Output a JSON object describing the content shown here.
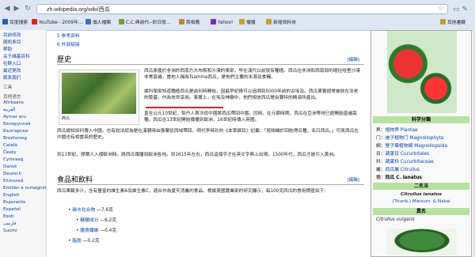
{
  "browser": {
    "url": "zh.wikipedia.org/wiki/西瓜",
    "bookmarks": [
      "百度搜索",
      "YouTube - 2009年...",
      "個人檔案",
      "C.C.典前代--即日般...",
      "我相應",
      "Yahoo!",
      "播播",
      "新增資料夾"
    ],
    "other_bookmarks": "其他書籤"
  },
  "sidebar": {
    "items": [
      "目前修改",
      "随机条目",
      "帮助",
      "关于维基百科",
      "社群入口",
      "最近更改",
      "联系我们",
      "工具",
      "其他语言",
      "Afrikaans",
      "العربية",
      "Aymar aru",
      "Беларуская",
      "Български",
      "Brezhoneg",
      "Català",
      "Česky",
      "Cymraeg",
      "Dansk",
      "Deutsch",
      "Ελληνικά",
      "Emiliàn e rumagnòl",
      "English",
      "Esperanto",
      "Español",
      "Eesti",
      "فارسی",
      "Suomi"
    ]
  },
  "content": {
    "toc": [
      "5 参考资料",
      "6 外部链接"
    ],
    "section_history": "歷史",
    "edit_label": "[編輯]",
    "history_para1": "西瓜原產於非洲的西南方大布斯和沙漠的東部，早在漢代以前就有種植。西瓜在非洲和西南部的喀拉哈里沙漠非常普遍，當地人稱為Tsamma西瓜，是他們主要的水源及食糧。",
    "history_para2": "據科學家知道種植西瓜是由何時開始，因最早紀錄可以追溯到5000年前的古埃及。西瓜果實經常被放在法老的陵墓，作為來世享用。事實上，在埃及神廟中，他們相信西瓜是由賽特的精液所產出。",
    "history_para3": "直至公元10世紀，契丹人首次從中國將西瓜帶回中國。同時，在元朝時期，西瓜在亞洲等地已經開始普遍栽種，西瓜在13世紀開始傳播到歐洲，16世紀時傳入英國。",
    "thumb_caption": "西瓜",
    "history_para4": "西瓜據知如何傳入中國，也有說法認為是在漢朝時由張騫從西域帶回。明代李時珍的《本草綱目》記載：「按胡嶠於回紇得瓜種，名曰西瓜。」可見西瓜在中國也有相當長的歷史。",
    "history_para5": "到13世紀，摩爾人入侵歐洲時，將西瓜傳播到歐洲各地。到1615年左右，西瓜這個字才在英文字典上出現。1500年代，西瓜才被引入美洲。",
    "section_food": "食品和飲料",
    "food_para": "西瓜果瓤多汁，含有豐富的維生素A及維生素C，適合作為夏天消暑的食品。根據美國農業部的研究顯示，每100克西瓜的食用價值如下：",
    "nutrition": [
      {
        "label": "碳水化合物",
        "value": "7.6克",
        "sub": false
      },
      {
        "label": "糖類成分",
        "value": "6.2克",
        "sub": true
      },
      {
        "label": "膳食纖維",
        "value": "0.4克",
        "sub": true
      },
      {
        "label": "脂肪",
        "value": "0.2克",
        "sub": false
      }
    ]
  },
  "infobox": {
    "classification_header": "科学分類",
    "rows": [
      {
        "key": "界：",
        "value": "植物界 Plantae"
      },
      {
        "key": "门：",
        "value": "被子植物门 Magnoliophyta"
      },
      {
        "key": "綱：",
        "value": "雙子葉植物綱 Magnoliopsida"
      },
      {
        "key": "目：",
        "value": "葫蘆目 Cucurbitales"
      },
      {
        "key": "科：",
        "value": "葫蘆科 Cucurbitaceae"
      },
      {
        "key": "屬：",
        "value": "西瓜屬 Citrullus"
      },
      {
        "key": "種：",
        "value": "西瓜 C. lanatus"
      }
    ],
    "binomial_header": "二名法",
    "binomial": "Citrullus lanatus",
    "binomial_author": "(Thunb.) Matsum. & Nakai",
    "synonym_header": "異名",
    "synonym": "Citrullus vulgaris",
    "colors": {
      "bar": "#b6e39f",
      "link": "#0645ad"
    }
  }
}
